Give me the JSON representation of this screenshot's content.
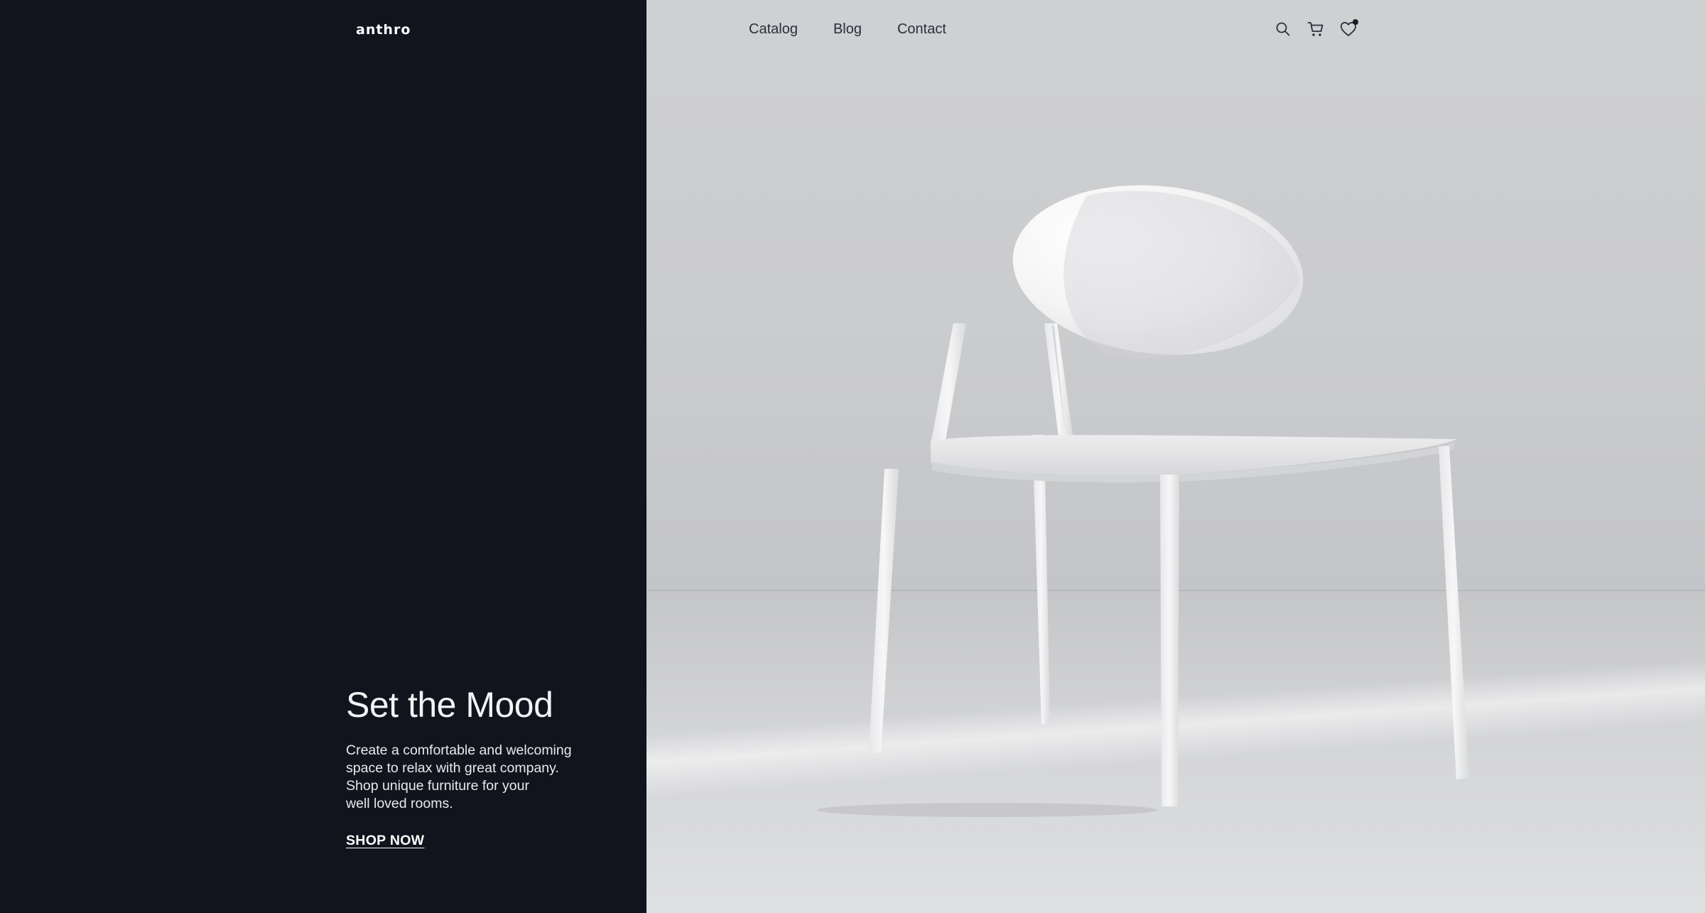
{
  "brand": {
    "logo_text": "anthro"
  },
  "nav": {
    "items": [
      {
        "label": "Catalog"
      },
      {
        "label": "Blog"
      },
      {
        "label": "Contact"
      }
    ]
  },
  "header_icons": {
    "search": "search-icon",
    "cart": "cart-icon",
    "wishlist": "heart-icon",
    "wishlist_has_badge": true
  },
  "hero": {
    "title": "Set the Mood",
    "text": "Create a comfortable and welcoming\nspace to relax with great company.\nShop unique furniture for your\nwell loved rooms.",
    "cta_label": "SHOP NOW"
  },
  "colors": {
    "dark_panel": "#11141c",
    "image_background": "#cdcecf",
    "nav_text": "#2a2f3b",
    "hero_text": "#f2f3f5"
  }
}
